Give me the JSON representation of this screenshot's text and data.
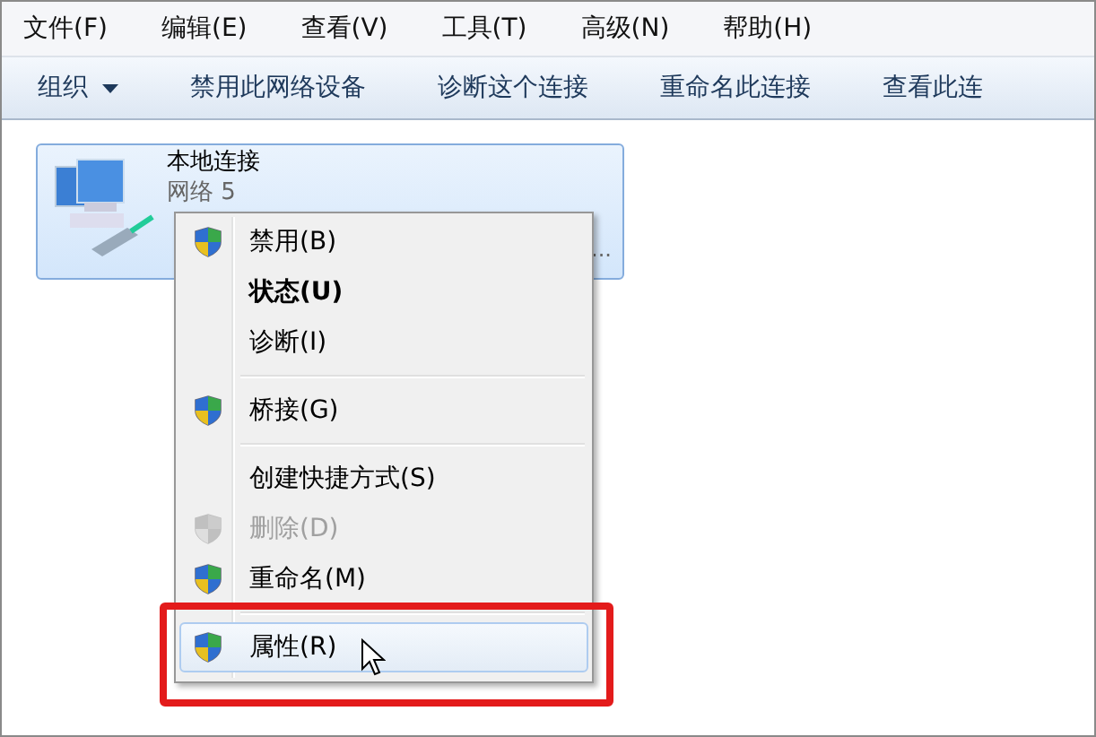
{
  "menu_bar": [
    {
      "label": "文件(F)"
    },
    {
      "label": "编辑(E)"
    },
    {
      "label": "查看(V)"
    },
    {
      "label": "工具(T)"
    },
    {
      "label": "高级(N)"
    },
    {
      "label": "帮助(H)"
    }
  ],
  "toolbar": [
    {
      "label": "组织",
      "dropdown": true
    },
    {
      "label": "禁用此网络设备",
      "dropdown": false
    },
    {
      "label": "诊断这个连接",
      "dropdown": false
    },
    {
      "label": "重命名此连接",
      "dropdown": false
    },
    {
      "label": "查看此连",
      "dropdown": false
    }
  ],
  "connection": {
    "name": "本地连接",
    "network": "网络 5",
    "more": "...",
    "selected": true
  },
  "context_menu": [
    {
      "kind": "item",
      "label": "禁用(B)",
      "shield": true,
      "bold": false,
      "disabled": false,
      "selected": false
    },
    {
      "kind": "item",
      "label": "状态(U)",
      "shield": false,
      "bold": true,
      "disabled": false,
      "selected": false
    },
    {
      "kind": "item",
      "label": "诊断(I)",
      "shield": false,
      "bold": false,
      "disabled": false,
      "selected": false
    },
    {
      "kind": "separator"
    },
    {
      "kind": "item",
      "label": "桥接(G)",
      "shield": true,
      "bold": false,
      "disabled": false,
      "selected": false
    },
    {
      "kind": "separator"
    },
    {
      "kind": "item",
      "label": "创建快捷方式(S)",
      "shield": false,
      "bold": false,
      "disabled": false,
      "selected": false
    },
    {
      "kind": "item",
      "label": "删除(D)",
      "shield": true,
      "bold": false,
      "disabled": true,
      "selected": false
    },
    {
      "kind": "item",
      "label": "重命名(M)",
      "shield": true,
      "bold": false,
      "disabled": false,
      "selected": false
    },
    {
      "kind": "separator"
    },
    {
      "kind": "item",
      "label": "属性(R)",
      "shield": true,
      "bold": false,
      "disabled": false,
      "selected": true,
      "highlighted": true
    }
  ]
}
